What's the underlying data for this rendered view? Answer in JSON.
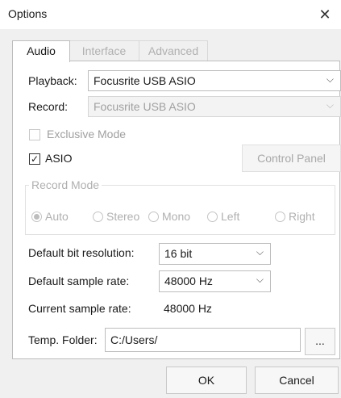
{
  "window": {
    "title": "Options",
    "close_icon": "close-icon"
  },
  "tabs": [
    {
      "label": "Audio",
      "active": true
    },
    {
      "label": "Interface",
      "active": false
    },
    {
      "label": "Advanced",
      "active": false
    }
  ],
  "playback": {
    "label": "Playback:",
    "value": "Focusrite USB ASIO"
  },
  "record": {
    "label": "Record:",
    "value": "Focusrite USB ASIO"
  },
  "exclusive_mode": {
    "label": "Exclusive Mode",
    "checked": false
  },
  "asio": {
    "label": "ASIO",
    "checked": true
  },
  "control_panel_button": "Control Panel",
  "record_mode": {
    "title": "Record Mode",
    "options": [
      {
        "label": "Auto",
        "selected": true
      },
      {
        "label": "Stereo",
        "selected": false
      },
      {
        "label": "Mono",
        "selected": false
      },
      {
        "label": "Left",
        "selected": false
      },
      {
        "label": "Right",
        "selected": false
      }
    ]
  },
  "bit_resolution": {
    "label": "Default bit resolution:",
    "value": "16 bit"
  },
  "sample_rate": {
    "label": "Default sample rate:",
    "value": "48000 Hz"
  },
  "current_sample_rate": {
    "label": "Current sample rate:",
    "value": "48000 Hz"
  },
  "temp_folder": {
    "label": "Temp. Folder:",
    "value": "C:/Users/",
    "browse": "..."
  },
  "buttons": {
    "ok": "OK",
    "cancel": "Cancel"
  },
  "glyphs": {
    "close": "✕",
    "chevron": "⌵",
    "check": "✓"
  }
}
